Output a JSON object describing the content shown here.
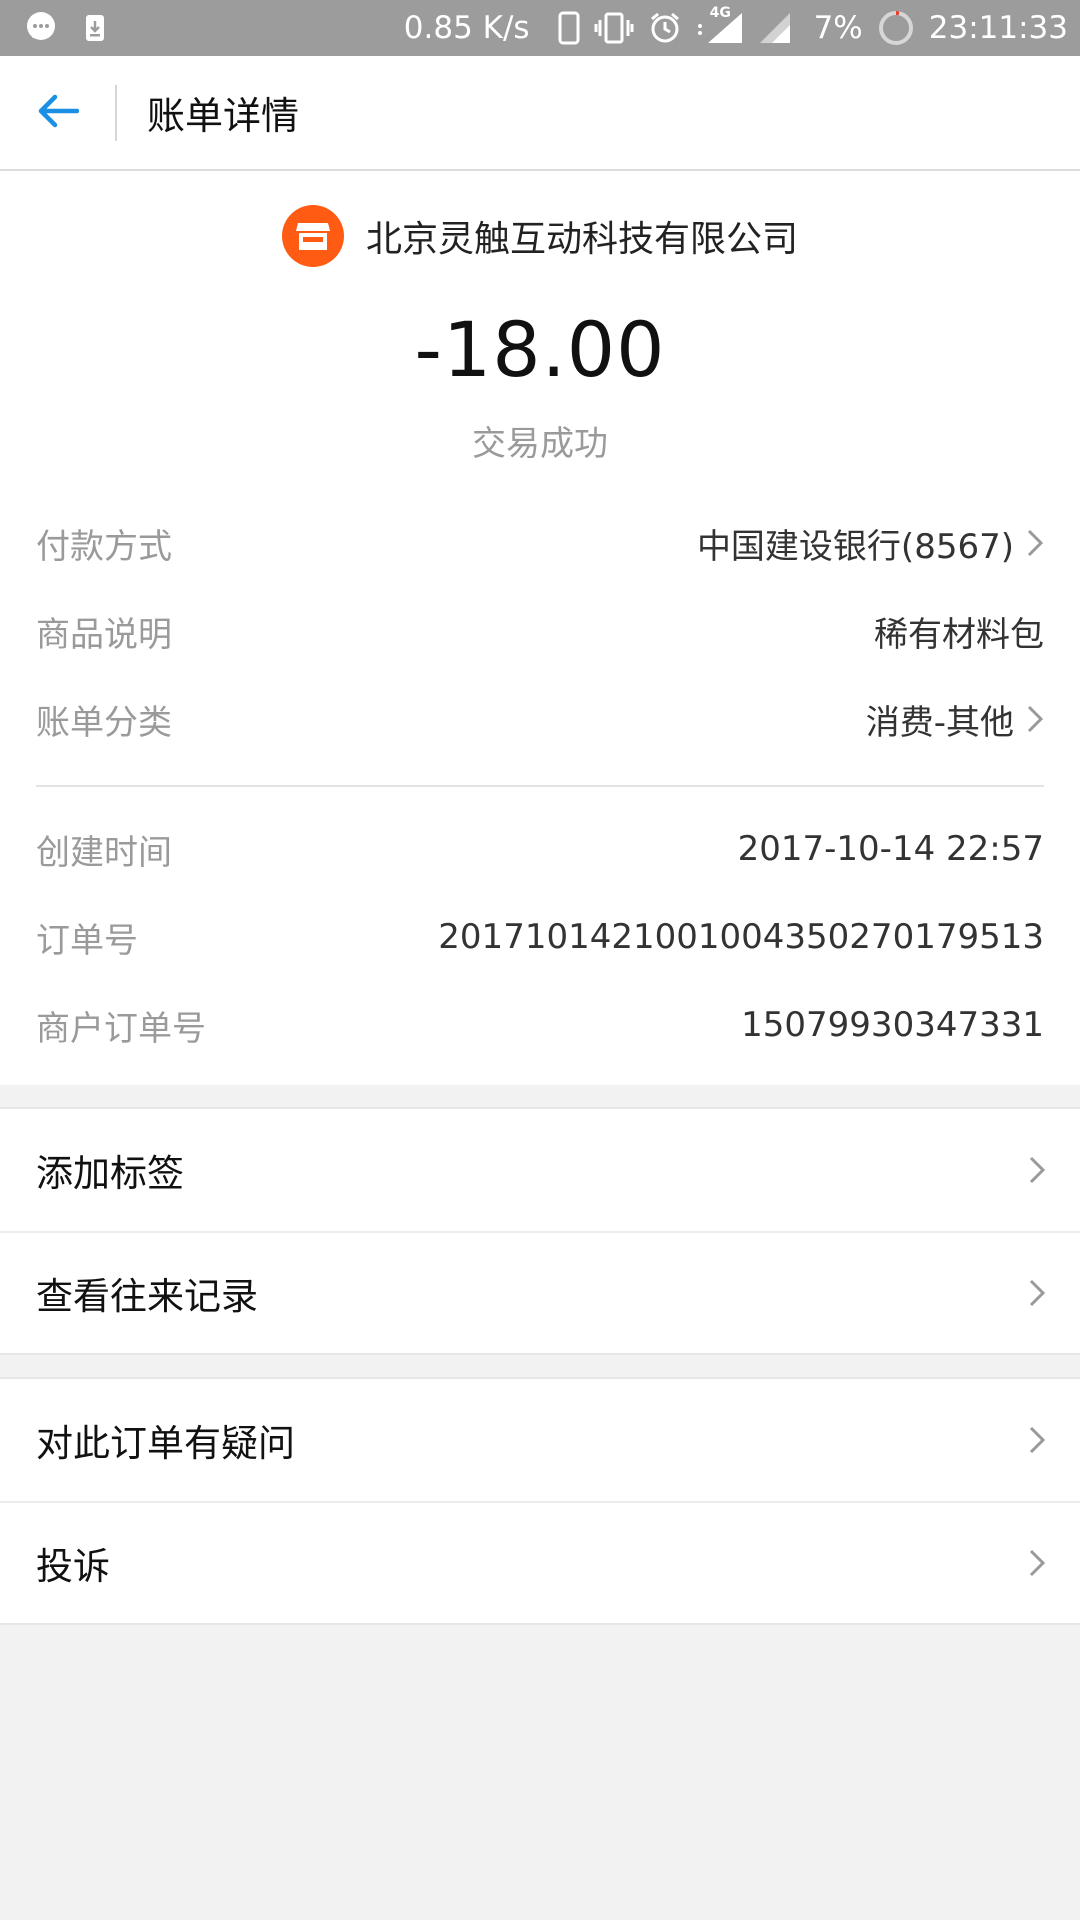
{
  "status_bar": {
    "network_speed": "0.85 K/s",
    "network_type": "4G",
    "battery": "7%",
    "time": "23:11:33",
    "icons": [
      "message-icon",
      "download-icon",
      "phone-icon",
      "vibrate-icon",
      "alarm-icon",
      "signal-icon",
      "signal-2-icon",
      "battery-icon"
    ]
  },
  "header": {
    "title": "账单详情",
    "back_icon": "back-arrow-icon"
  },
  "summary": {
    "merchant_name": "北京灵触互动科技有限公司",
    "merchant_icon": "shop-icon",
    "amount": "-18.00",
    "status": "交易成功"
  },
  "details": {
    "payment_method_label": "付款方式",
    "payment_method_value": "中国建设银行(8567)",
    "product_label": "商品说明",
    "product_value": "稀有材料包",
    "category_label": "账单分类",
    "category_value": "消费-其他",
    "created_label": "创建时间",
    "created_value": "2017-10-14 22:57",
    "order_label": "订单号",
    "order_value": "2017101421001004350270179513",
    "merchant_order_label": "商户订单号",
    "merchant_order_value": "15079930347331"
  },
  "actions": {
    "add_tag": "添加标签",
    "view_records": "查看往来记录",
    "question": "对此订单有疑问",
    "complaint": "投诉"
  },
  "colors": {
    "accent": "#1a8fe3",
    "merchant_logo": "#ff5b13",
    "background": "#f2f2f2"
  }
}
